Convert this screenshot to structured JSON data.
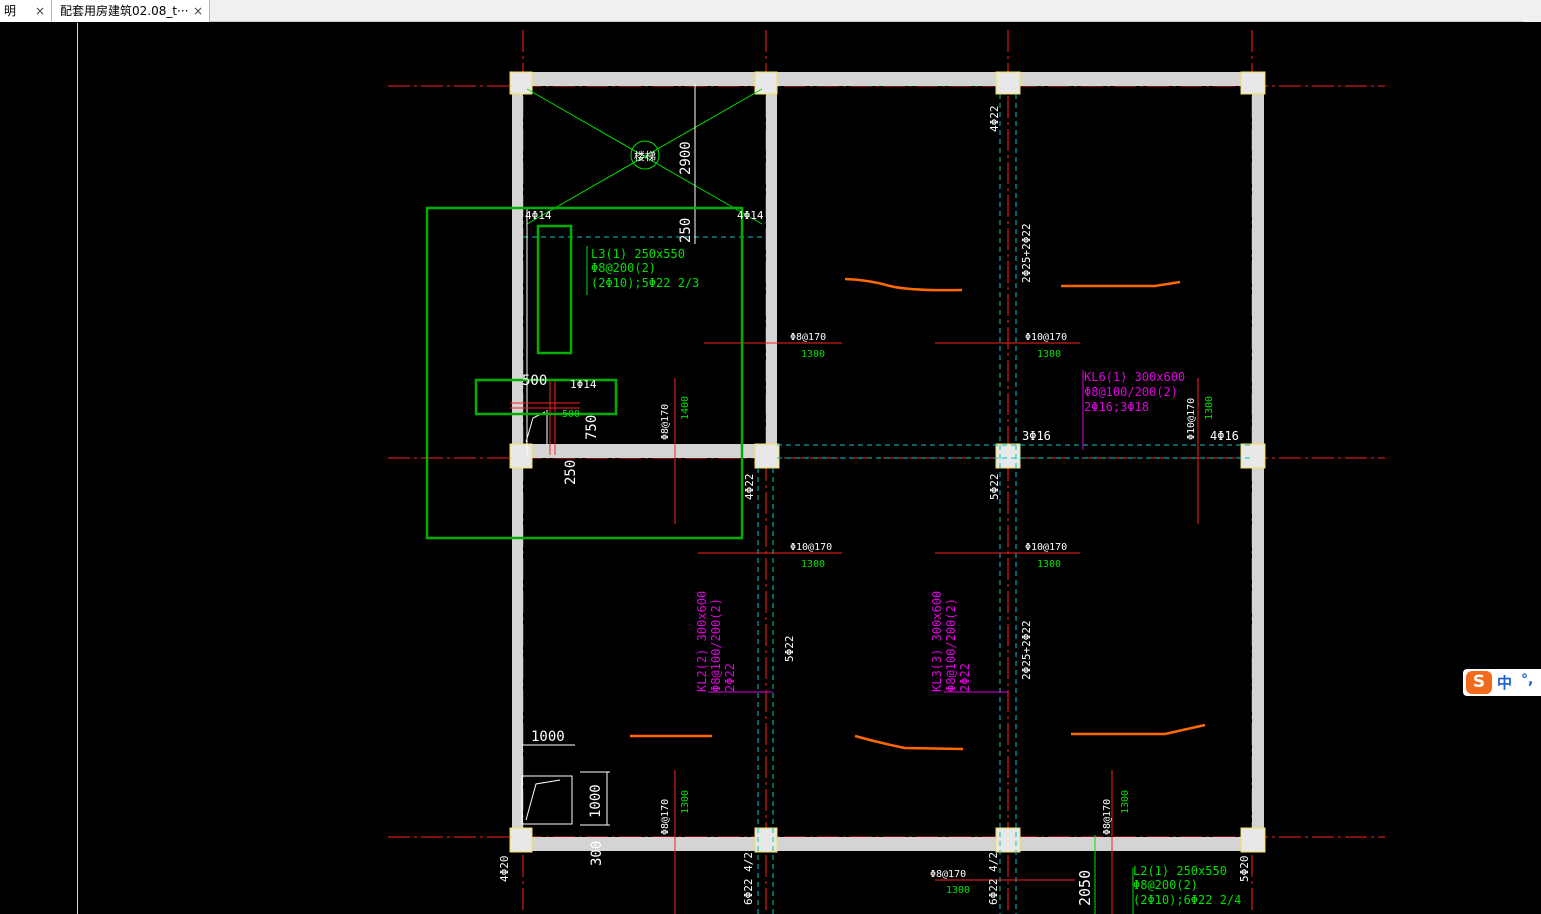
{
  "tabs": [
    {
      "label": "明",
      "close": "×"
    },
    {
      "label": "配套用房建筑02.08_t···",
      "close": "×"
    }
  ],
  "ime": {
    "logo": "S",
    "mode": "中",
    "punct": "°,"
  },
  "drawing": {
    "stair_label": "楼梯",
    "dim_2900": "2900",
    "dim_250_a": "250",
    "dim_250_b": "250",
    "dim_500": "500",
    "dim_750": "750",
    "dim_1000": "1000",
    "dim_1000_v": "1000",
    "dim_300": "300",
    "dim_2050": "2050",
    "rebar_4phi14_a": "4Φ14",
    "rebar_4phi14_b": "4Φ14",
    "rebar_1phi14": "1Φ14",
    "rebar_500": "500",
    "beam_L3": [
      "L3(1) 250x550",
      "Φ8@200(2)",
      "(2Φ10);5Φ22 2/3"
    ],
    "beam_KL6": [
      "KL6(1) 300x600",
      "Φ8@100/200(2)",
      "2Φ16;3Φ18"
    ],
    "beam_KL2": [
      "KL2(2) 300x600",
      "Φ8@100/200(2)",
      "2Φ22"
    ],
    "beam_KL3": [
      "KL3(3) 300x600",
      "Φ8@100/200(2)",
      "2Φ22"
    ],
    "beam_L2": [
      "L2(1) 250x550",
      "Φ8@200(2)",
      "(2Φ10);6Φ22 2/4"
    ],
    "slab_bars": {
      "b1": "Φ8@170",
      "b2": "Φ10@170",
      "b3": "Φ10@170",
      "b4": "Φ10@170",
      "b5": "Φ8@170",
      "b6": "Φ10@170",
      "b7": "Φ8@170",
      "b8": "Φ8@170",
      "b9": "Φ8@170",
      "b10": "Φ8@170"
    },
    "slab_len": {
      "l1": "1300",
      "l2": "1300",
      "l3": "1300",
      "l4": "1300",
      "l5": "1400",
      "l6": "1300",
      "l7": "1300",
      "l8": "1300",
      "l9": "1300"
    },
    "rebar_4phi22_top": "4Φ22",
    "rebar_2phi25_top": "2Φ25+2Φ22",
    "rebar_3phi16": "3Φ16",
    "rebar_4phi16": "4Φ16",
    "rebar_4phi22_mid": "4Φ22",
    "rebar_5phi22_mid": "5Φ22",
    "rebar_5phi22_low": "5Φ22",
    "rebar_2phi25_low": "2Φ25+2Φ22",
    "rebar_4phi20": "4Φ20",
    "rebar_5phi20": "5Φ20",
    "rebar_6phi22_a": "6Φ22 4/2",
    "rebar_6phi22_b": "6Φ22 4/2",
    "colors": {
      "background": "#000000",
      "wall": "#d4d4d4",
      "axis": "#ff2020",
      "green": "#00e000",
      "magenta": "#e000e0",
      "cyan": "#00c8c8",
      "orange": "#ff6a00",
      "white": "#ffffff",
      "selection": "#00b000"
    }
  }
}
